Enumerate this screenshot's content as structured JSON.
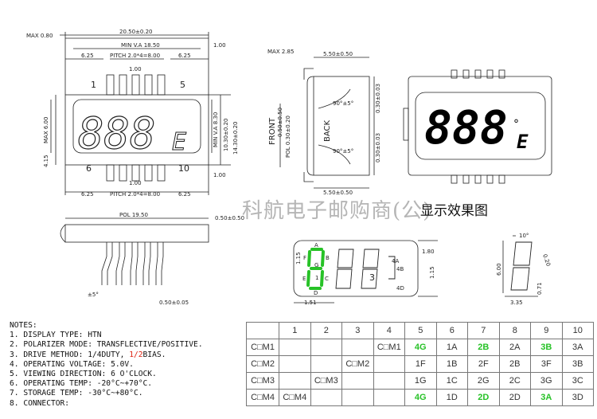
{
  "front_view": {
    "max_top": "MAX 0.80",
    "overall_width": "20.50±0.20",
    "min_va_width": "MIN V.A 18.50",
    "edge_dim": "1.00",
    "left_offset": "6.25",
    "pitch": "PITCH 2.0*4=8.00",
    "right_offset": "6.25",
    "pin_width": "1.00",
    "pin_label_1": "1",
    "pin_label_5": "5",
    "pin_label_6": "6",
    "pin_label_10": "10",
    "min_va_height": "MIN V.A 8.30",
    "height_1": "10.30±0.20",
    "height_2": "14.30±0.20",
    "max_height": "MAX 6.00",
    "left_small": "4.15",
    "edge_bottom": "1.00",
    "bottom_left_offset": "6.25",
    "bottom_pitch": "PITCH 2.0*4=8.00",
    "bottom_right_offset": "6.25",
    "bottom_pin": "1.00",
    "digits": "888",
    "suffix": "E"
  },
  "side_view": {
    "max_top": "MAX 2.85",
    "top_dim": "5.50±0.50",
    "front_label": "FRONT",
    "back_label": "BACK",
    "pol_label": "POL 0.30±0.20",
    "lead_dim": "0.50±0.50",
    "angle_top": "90°±5°",
    "angle_bottom": "90°±5°",
    "right_top": "0.30±0.03",
    "right_bottom": "0.30±0.03",
    "bottom_dim": "5.50±0.50"
  },
  "effect_view": {
    "digits": "888",
    "suffix": "E",
    "degree": "°",
    "label": "显示效果图"
  },
  "watermark": "科航电子邮购商(公)",
  "bottom_view": {
    "pol": "POL 19.50",
    "pol_right": "0.50±0.50",
    "angle": "±5°",
    "pin_dim": "0.50±0.05"
  },
  "segment_view": {
    "dim_top": "1.80",
    "dim_left": "1.15",
    "dim_right": "1.15",
    "dim_bottom": "1.51",
    "digit_index_1": "1",
    "digit_index_3": "3",
    "seg_letters": [
      "A",
      "B",
      "C",
      "D",
      "E",
      "F",
      "G"
    ],
    "label_4a": "4A",
    "label_4b": "4B",
    "label_4d": "4D"
  },
  "digit_detail": {
    "angle": "10°",
    "width": "0.20",
    "height": "6.00",
    "bottom": "3.35",
    "small": "0.71"
  },
  "notes": {
    "heading": "NOTES:",
    "items": [
      "1. DISPLAY TYPE: HTN",
      "2. POLARIZER MODE: TRANSFLECTIVE/POSITIVE.",
      "3. DRIVE METHOD: 1/4DUTY, ",
      "4. OPERATING VOLTAGE: 5.0V.",
      "5. VIEWING DIRECTION: 6 O'CLOCK.",
      "6. OPERATING TEMP: -20°C~+70°C.",
      "7. STORAGE TEMP: -30°C~+80°C.",
      "8. CONNECTOR:"
    ],
    "bias_value": "1/2",
    "bias_suffix": "BIAS."
  },
  "pin_table": {
    "headers": [
      "",
      "1",
      "2",
      "3",
      "4",
      "5",
      "6",
      "7",
      "8",
      "9",
      "10"
    ],
    "rows": [
      [
        "C□M1",
        "",
        "",
        "",
        "C□M1",
        "4G",
        "1A",
        "2B",
        "2A",
        "3B",
        "3A"
      ],
      [
        "C□M2",
        "",
        "",
        "C□M2",
        "",
        "1F",
        "1B",
        "2F",
        "2B",
        "3F",
        "3B"
      ],
      [
        "C□M3",
        "",
        "C□M3",
        "",
        "",
        "1G",
        "1C",
        "2G",
        "2C",
        "3G",
        "3C"
      ],
      [
        "C□M4",
        "C□M4",
        "",
        "",
        "",
        "4G",
        "1D",
        "2D",
        "2D",
        "3A",
        "3D"
      ]
    ],
    "green_cells": [
      "0-5",
      "0-7",
      "0-9",
      "3-5",
      "3-7",
      "3-9"
    ]
  },
  "colors": {
    "line": "#222222",
    "segment_green": "#27c227",
    "accent_red": "#dd2211"
  }
}
